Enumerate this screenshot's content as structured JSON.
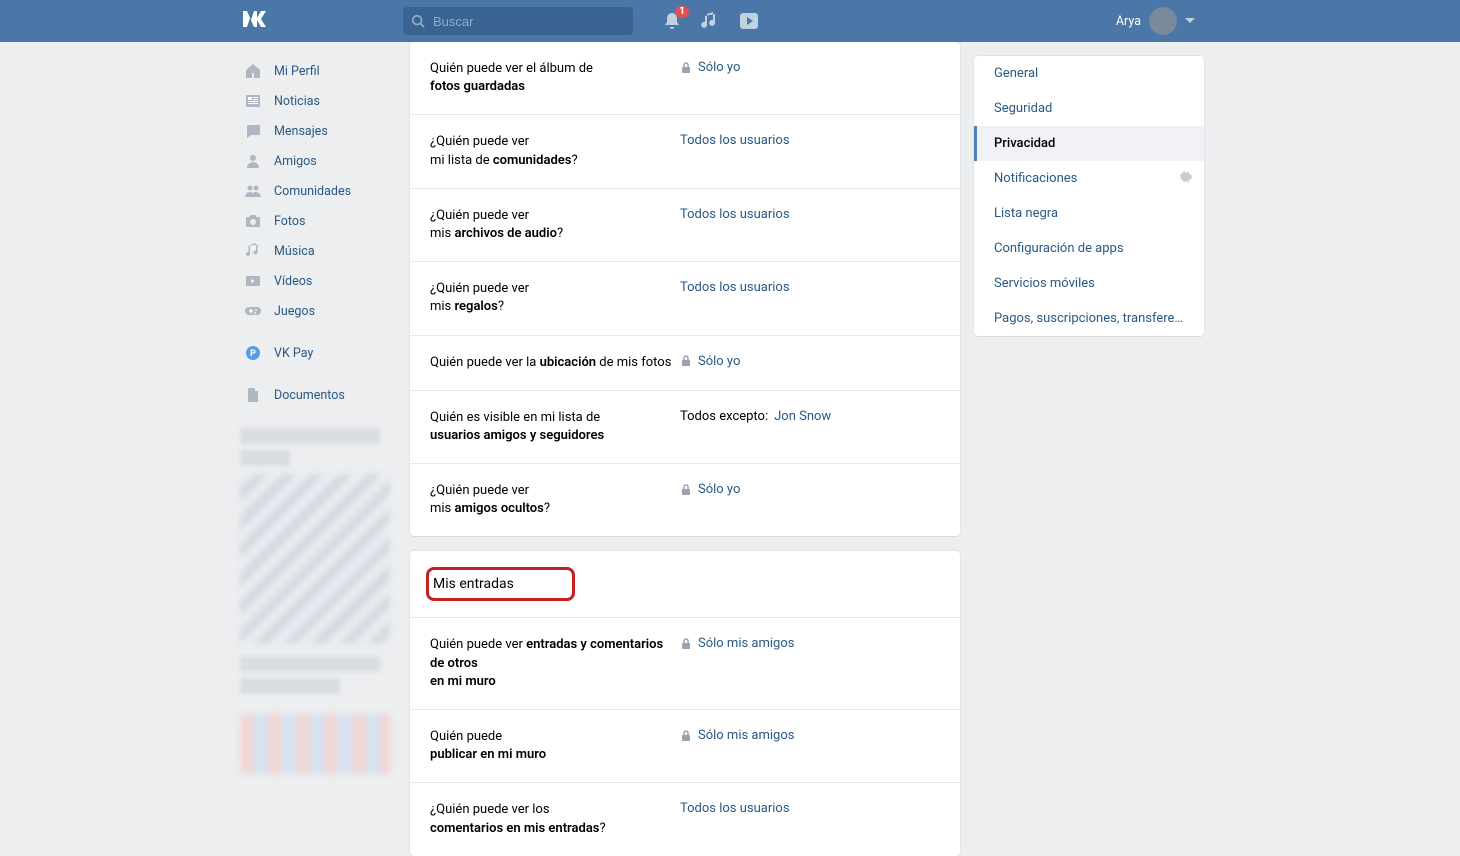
{
  "header": {
    "search_placeholder": "Buscar",
    "user_name": "Arya",
    "notification_count": "1"
  },
  "left_nav": [
    {
      "icon": "home",
      "label": "Mi Perfil"
    },
    {
      "icon": "news",
      "label": "Noticias"
    },
    {
      "icon": "chat",
      "label": "Mensajes"
    },
    {
      "icon": "user",
      "label": "Amigos"
    },
    {
      "icon": "group",
      "label": "Comunidades"
    },
    {
      "icon": "camera",
      "label": "Fotos"
    },
    {
      "icon": "music",
      "label": "Música"
    },
    {
      "icon": "video",
      "label": "Vídeos"
    },
    {
      "icon": "game",
      "label": "Juegos"
    },
    {
      "icon": "pay",
      "label": "VK Pay"
    },
    {
      "icon": "doc",
      "label": "Documentos"
    }
  ],
  "privacy_rows_1": [
    {
      "label_pre": "Quién puede ver el álbum de",
      "label_bold": "fotos guardadas",
      "label_post": "",
      "value": "Sólo yo",
      "locked": true
    },
    {
      "label_pre": "¿Quién puede ver",
      "label_bold_pre": "mi lista de ",
      "label_bold": "comunidades",
      "label_post": "?",
      "value": "Todos los usuarios",
      "locked": false
    },
    {
      "label_pre": "¿Quién puede ver",
      "label_bold_pre": "mis ",
      "label_bold": "archivos de audio",
      "label_post": "?",
      "value": "Todos los usuarios",
      "locked": false
    },
    {
      "label_pre": "¿Quién puede ver",
      "label_bold_pre": "mis ",
      "label_bold": "regalos",
      "label_post": "?",
      "value": "Todos los usuarios",
      "locked": false
    },
    {
      "label_pre": "Quién puede ver la ",
      "label_bold_inline": "ubicación",
      "label_after": " de mis fotos",
      "value": "Sólo yo",
      "locked": true
    },
    {
      "label_pre": "Quién es visible en mi lista de",
      "label_bold": "usuarios amigos y seguidores",
      "label_post": "",
      "except_prefix": "Todos excepto: ",
      "except_name": "Jon Snow",
      "locked": false,
      "is_except": true
    },
    {
      "label_pre": "¿Quién puede ver",
      "label_bold_pre": "mis ",
      "label_bold": "amigos ocultos",
      "label_post": "?",
      "value": "Sólo yo",
      "locked": true
    }
  ],
  "section2_title": "Mis entradas",
  "privacy_rows_2": [
    {
      "label_line1_pre": "Quién puede ver ",
      "label_line1_bold": "entradas y comentarios de otros",
      "label_line2_bold": "en mi muro",
      "value": "Sólo mis amigos",
      "locked": true
    },
    {
      "label_line1": "Quién puede",
      "label_line2_bold": "publicar en mi muro",
      "value": "Sólo mis amigos",
      "locked": true
    },
    {
      "label_line1": "¿Quién puede ver los",
      "label_line2_bold": "comentarios en mis entradas",
      "label_line2_post": "?",
      "value": "Todos los usuarios",
      "locked": false
    }
  ],
  "settings_menu": [
    {
      "label": "General",
      "active": false
    },
    {
      "label": "Seguridad",
      "active": false
    },
    {
      "label": "Privacidad",
      "active": true
    },
    {
      "label": "Notificaciones",
      "active": false,
      "gear": true
    },
    {
      "label": "Lista negra",
      "active": false
    },
    {
      "label": "Configuración de apps",
      "active": false
    },
    {
      "label": "Servicios móviles",
      "active": false
    },
    {
      "label": "Pagos, suscripciones, transferencias",
      "active": false
    }
  ]
}
